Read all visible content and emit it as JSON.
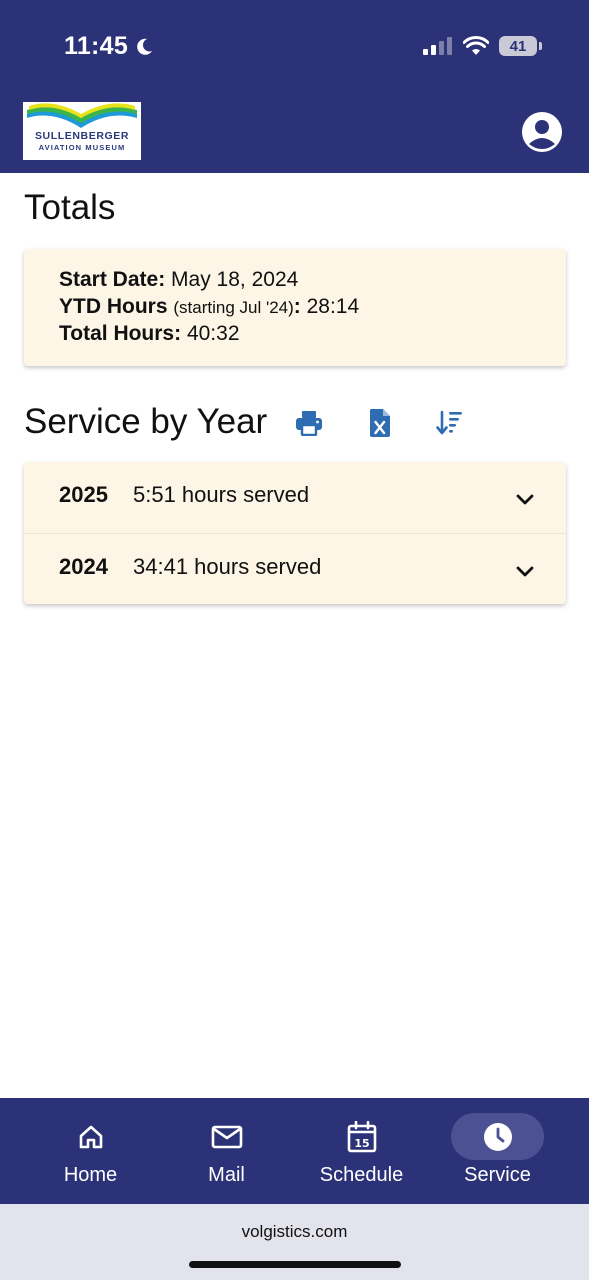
{
  "status_bar": {
    "time": "11:45",
    "battery": "41"
  },
  "header": {
    "logo_line1": "SULLENBERGER",
    "logo_line2": "AVIATION MUSEUM",
    "account_icon": "account-circle-icon"
  },
  "totals": {
    "title": "Totals",
    "start_date_label": "Start Date:",
    "start_date_value": "May 18, 2024",
    "ytd_label": "YTD Hours",
    "ytd_note": "(starting Jul '24)",
    "ytd_colon": ":",
    "ytd_value": "28:14",
    "total_label": "Total Hours:",
    "total_value": "40:32"
  },
  "service_by_year": {
    "title": "Service by Year",
    "tools": [
      "print-icon",
      "excel-file-icon",
      "sort-icon"
    ],
    "rows": [
      {
        "year": "2025",
        "hours": "5:51 hours served"
      },
      {
        "year": "2024",
        "hours": "34:41 hours served"
      }
    ]
  },
  "bottom_nav": {
    "items": [
      {
        "label": "Home",
        "icon": "home-icon"
      },
      {
        "label": "Mail",
        "icon": "mail-icon"
      },
      {
        "label": "Schedule",
        "icon": "calendar-icon",
        "icon_text": "15"
      },
      {
        "label": "Service",
        "icon": "clock-icon"
      }
    ],
    "active": "Service"
  },
  "browser": {
    "url": "volgistics.com"
  },
  "colors": {
    "header_bg": "#2c3278",
    "card_bg": "#fdf5e6",
    "accent_icon": "#2f6db3",
    "browser_bar": "#e3e3ed"
  }
}
